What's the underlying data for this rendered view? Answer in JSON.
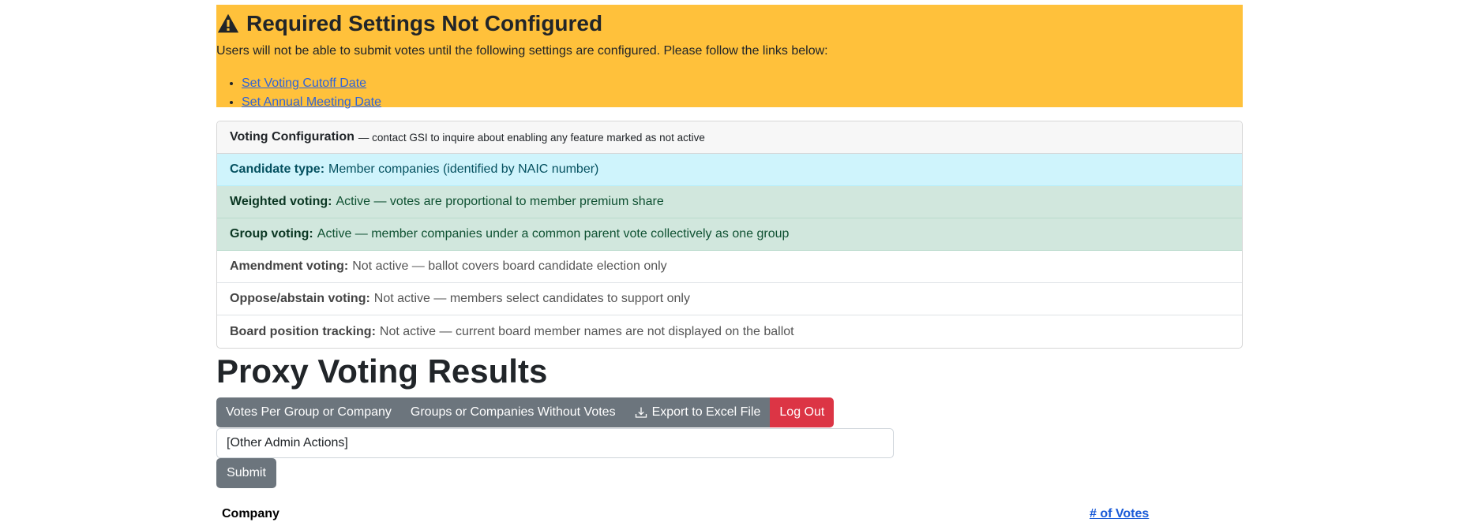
{
  "alert": {
    "title": "Required Settings Not Configured",
    "message": "Users will not be able to submit votes until the following settings are configured. Please follow the links below:",
    "links": [
      "Set Voting Cutoff Date",
      "Set Annual Meeting Date"
    ]
  },
  "config": {
    "header_title": "Voting Configuration",
    "header_note": "— contact GSI to inquire about enabling any feature marked as not active",
    "rows": [
      {
        "label": "Candidate type:",
        "value": "Member companies (identified by NAIC number)",
        "status": "info"
      },
      {
        "label": "Weighted voting:",
        "value": "Active — votes are proportional to member premium share",
        "status": "success"
      },
      {
        "label": "Group voting:",
        "value": "Active — member companies under a common parent vote collectively as one group",
        "status": "success"
      },
      {
        "label": "Amendment voting:",
        "value": "Not active — ballot covers board candidate election only",
        "status": "plain"
      },
      {
        "label": "Oppose/abstain voting:",
        "value": "Not active — members select candidates to support only",
        "status": "plain"
      },
      {
        "label": "Board position tracking:",
        "value": "Not active — current board member names are not displayed on the ballot",
        "status": "plain"
      }
    ]
  },
  "page_title": "Proxy Voting Results",
  "toolbar": {
    "votes_per_group": "Votes Per Group or Company",
    "without_votes": "Groups or Companies Without Votes",
    "export": "Export to Excel File",
    "logout": "Log Out"
  },
  "admin_select": {
    "selected": "[Other Admin Actions]"
  },
  "submit_label": "Submit",
  "table": {
    "col_company": "Company",
    "col_votes": "# of Votes"
  },
  "colors": {
    "warning": "#ffc13b",
    "info": "#cff4fc",
    "success": "#d1e7dd",
    "secondary": "#6c757d",
    "danger": "#dc3545"
  }
}
